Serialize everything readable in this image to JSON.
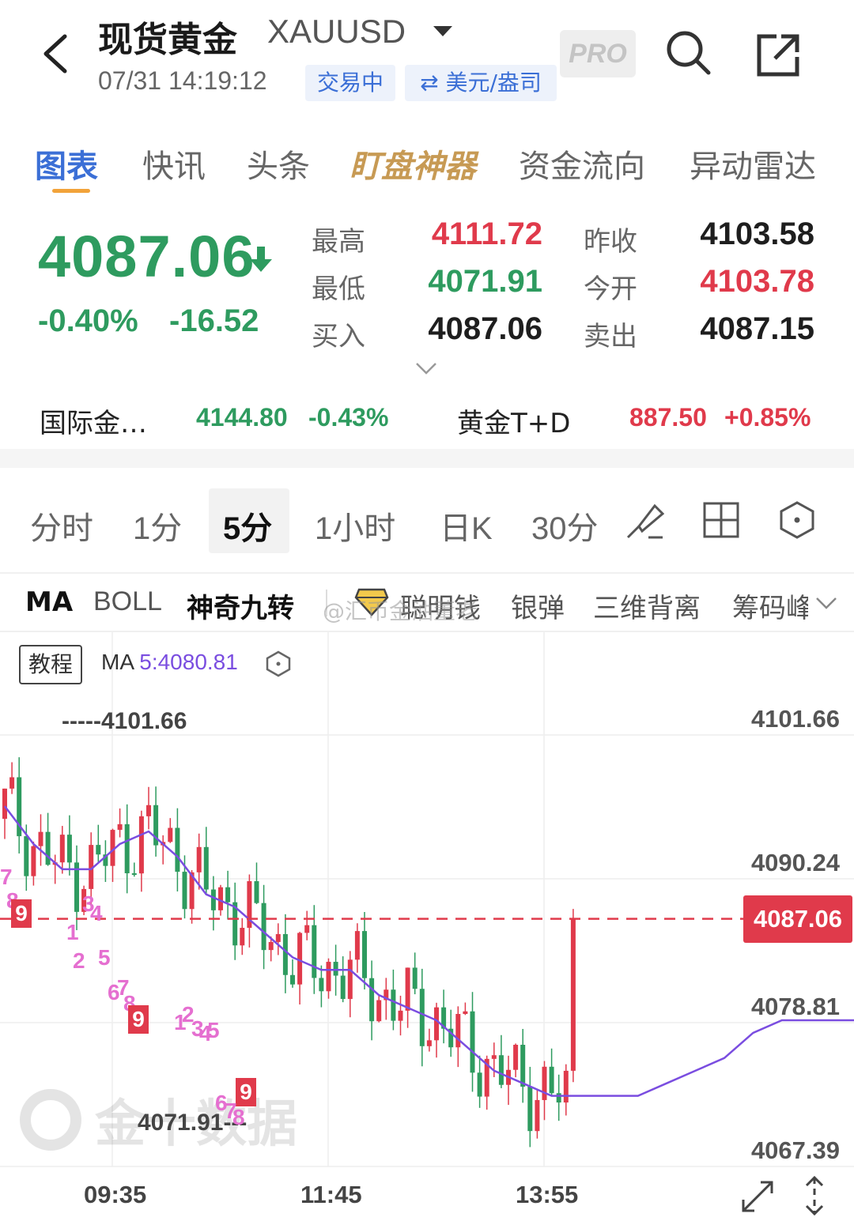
{
  "header": {
    "title": "现货黄金",
    "symbol": "XAUUSD",
    "timestamp": "07/31 14:19:12",
    "status_badge": "交易中",
    "unit_badge": "⇄ 美元/盎司",
    "pro_label": "PRO"
  },
  "tabs": [
    {
      "label": "图表",
      "active": true
    },
    {
      "label": "快讯"
    },
    {
      "label": "头条"
    },
    {
      "label": "盯盘神器"
    },
    {
      "label": "资金流向"
    },
    {
      "label": "异动雷达"
    }
  ],
  "quote": {
    "price": "4087.06",
    "change_pct": "-0.40%",
    "change": "-16.52",
    "high_label": "最高",
    "high": "4111.72",
    "low_label": "最低",
    "low": "4071.91",
    "bid_label": "买入",
    "bid": "4087.06",
    "prev_close_label": "昨收",
    "prev_close": "4103.58",
    "open_label": "今开",
    "open": "4103.78",
    "ask_label": "卖出",
    "ask": "4087.15"
  },
  "related": [
    {
      "name": "国际金…",
      "price": "4144.80",
      "change": "-0.43%",
      "color": "#2e9b5f"
    },
    {
      "name": "黄金T+D",
      "price": "887.50",
      "change": "+0.85%",
      "color": "#e03a4b"
    }
  ],
  "periods": [
    "分时",
    "1分",
    "5分",
    "1小时",
    "日K",
    "30分"
  ],
  "active_period": "5分",
  "indicators": [
    "MA",
    "BOLL",
    "神奇九转",
    "聪明钱",
    "银弹",
    "三维背离",
    "筹码峰"
  ],
  "watermark": "@汇币金油董老",
  "chart": {
    "tutorial_label": "教程",
    "ma_prefix": "MA",
    "ma_value": "5:4080.81",
    "y_labels": [
      "4101.66",
      "4090.24",
      "4078.81",
      "4067.39"
    ],
    "current_price_tag": "4087.06",
    "high_marker": "-----4101.66",
    "low_marker": "4071.91---",
    "x_labels": [
      "09:35",
      "11:45",
      "13:55"
    ],
    "logo_text": "金十数据"
  },
  "chart_data": {
    "type": "candlestick",
    "title": "",
    "ylim": [
      4067.39,
      4101.66
    ],
    "y_ticks": [
      4101.66,
      4090.24,
      4078.81,
      4067.39
    ],
    "x_ticks": [
      "09:35",
      "11:45",
      "13:55"
    ],
    "current_price": 4087.06,
    "period_high": 4101.66,
    "period_low": 4071.91,
    "ma5_last": 4080.81,
    "ma_series": [
      [
        0,
        4096
      ],
      [
        2,
        4093
      ],
      [
        4,
        4091
      ],
      [
        6,
        4091
      ],
      [
        8,
        4093
      ],
      [
        10,
        4094
      ],
      [
        12,
        4092
      ],
      [
        14,
        4089
      ],
      [
        16,
        4088
      ],
      [
        18,
        4086
      ],
      [
        20,
        4084
      ],
      [
        22,
        4083
      ],
      [
        24,
        4083
      ],
      [
        26,
        4081
      ],
      [
        28,
        4080
      ],
      [
        30,
        4079
      ],
      [
        32,
        4077
      ],
      [
        34,
        4075
      ],
      [
        36,
        4074
      ],
      [
        38,
        4073
      ],
      [
        40,
        4073
      ],
      [
        42,
        4073
      ],
      [
        44,
        4073
      ],
      [
        46,
        4074
      ],
      [
        48,
        4075
      ],
      [
        50,
        4076
      ],
      [
        52,
        4078
      ],
      [
        54,
        4079
      ],
      [
        56,
        4079
      ],
      [
        58,
        4079
      ],
      [
        60,
        4079
      ],
      [
        62,
        4080
      ],
      [
        64,
        4081
      ],
      [
        66,
        4081
      ],
      [
        68,
        4080
      ],
      [
        70,
        4078
      ],
      [
        72,
        4076
      ],
      [
        74,
        4076
      ],
      [
        76,
        4078
      ],
      [
        78,
        4081
      ]
    ],
    "colors": {
      "up": "#e03a4b",
      "down": "#2e9b5f",
      "ma": "#7a4de0",
      "seq": "#e56fd0"
    }
  }
}
